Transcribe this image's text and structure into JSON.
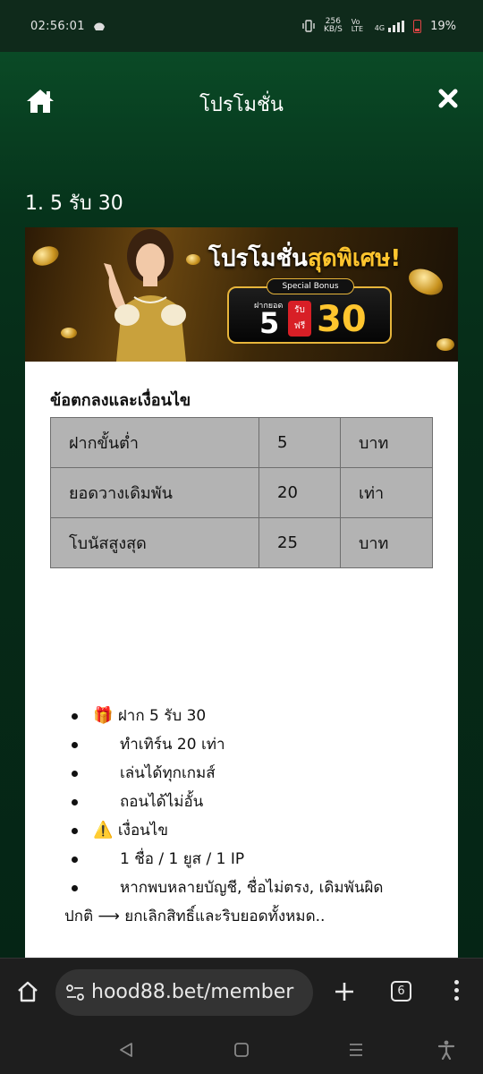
{
  "status_bar": {
    "time": "02:56:01",
    "net_speed_top": "256",
    "net_speed_bottom": "KB/S",
    "volte": "Vo LTE",
    "network": "4G",
    "battery": "19%"
  },
  "header": {
    "title": "โปรโมชั่น"
  },
  "promo": {
    "section_title": "1. 5 รับ 30",
    "banner": {
      "headline_white": "โปรโมชั่น",
      "headline_gold": "สุดพิเศษ!",
      "tag": "Special Bonus",
      "deposit_label": "ฝากยอด",
      "deposit_amount": "5",
      "receive_label_1": "รับ",
      "receive_label_2": "ฟรี",
      "bonus_amount": "30"
    },
    "terms_heading": "ข้อตกลงและเงื่อนไข",
    "terms_table": [
      [
        "ฝากขั้นต่ำ",
        "5",
        "บาท"
      ],
      [
        "ยอดวางเดิมพัน",
        "20",
        "เท่า"
      ],
      [
        "โบนัสสูงสุด",
        "25",
        "บาท"
      ]
    ],
    "bullets": [
      {
        "emoji": "🎁",
        "text": "ฝาก 5 รับ 30"
      },
      {
        "emoji": "",
        "text": "ทำเทิร์น 20 เท่า"
      },
      {
        "emoji": "",
        "text": "เล่นได้ทุกเกมส์"
      },
      {
        "emoji": "",
        "text": "ถอนได้ไม่อั้น"
      },
      {
        "emoji": "⚠️",
        "text": "เงื่อนไข"
      },
      {
        "emoji": "",
        "text": "1 ชื่อ / 1 ยูส / 1 IP"
      },
      {
        "emoji": "",
        "text": "หากพบหลายบัญชี, ชื่อไม่ตรง, เดิมพันผิด",
        "cont": "ปกติ ⟶ ยกเลิกสิทธิ์และริบยอดทั้งหมด.."
      }
    ]
  },
  "browser": {
    "url": "hood88.bet/member",
    "tab_count": "6"
  }
}
